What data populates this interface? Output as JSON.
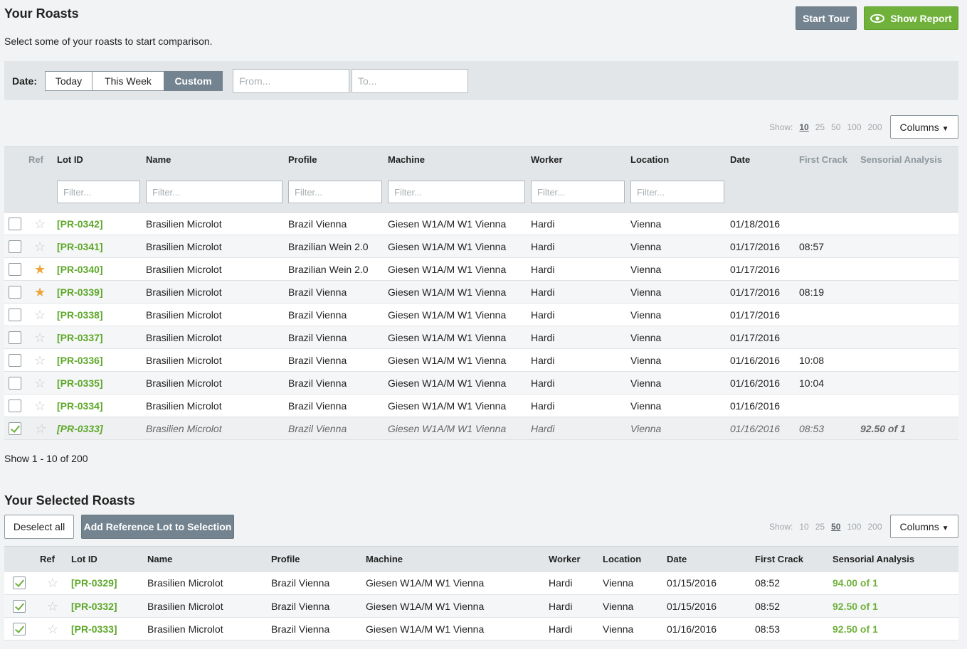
{
  "header": {
    "title": "Your Roasts",
    "subtitle": "Select some of your roasts to start comparison.",
    "tour_label": "Start Tour",
    "report_label": "Show Report"
  },
  "datebar": {
    "label": "Date:",
    "segments": [
      "Today",
      "This Week",
      "Custom"
    ],
    "active_segment": "Custom",
    "from_placeholder": "From...",
    "to_placeholder": "To..."
  },
  "pagination_top": {
    "show_label": "Show:",
    "options": [
      "10",
      "25",
      "50",
      "100",
      "200"
    ],
    "selected": "10",
    "columns_label": "Columns"
  },
  "roasts_table": {
    "headers": [
      "Ref",
      "Lot ID",
      "Name",
      "Profile",
      "Machine",
      "Worker",
      "Location",
      "Date",
      "First Crack",
      "Sensorial Analysis"
    ],
    "filter_placeholder": "Filter...",
    "rows": [
      {
        "checked": false,
        "starred": false,
        "lot": "[PR-0342]",
        "name": "Brasilien Microlot",
        "profile": "Brazil Vienna",
        "machine": "Giesen W1A/M W1 Vienna",
        "worker": "Hardi",
        "location": "Vienna",
        "date": "01/18/2016",
        "crack": "",
        "sens": ""
      },
      {
        "checked": false,
        "starred": false,
        "lot": "[PR-0341]",
        "name": "Brasilien Microlot",
        "profile": "Brazilian Wein 2.0",
        "machine": "Giesen W1A/M W1 Vienna",
        "worker": "Hardi",
        "location": "Vienna",
        "date": "01/17/2016",
        "crack": "08:57",
        "sens": ""
      },
      {
        "checked": false,
        "starred": true,
        "lot": "[PR-0340]",
        "name": "Brasilien Microlot",
        "profile": "Brazilian Wein 2.0",
        "machine": "Giesen W1A/M W1 Vienna",
        "worker": "Hardi",
        "location": "Vienna",
        "date": "01/17/2016",
        "crack": "",
        "sens": ""
      },
      {
        "checked": false,
        "starred": true,
        "lot": "[PR-0339]",
        "name": "Brasilien Microlot",
        "profile": "Brazil Vienna",
        "machine": "Giesen W1A/M W1 Vienna",
        "worker": "Hardi",
        "location": "Vienna",
        "date": "01/17/2016",
        "crack": "08:19",
        "sens": ""
      },
      {
        "checked": false,
        "starred": false,
        "lot": "[PR-0338]",
        "name": "Brasilien Microlot",
        "profile": "Brazil Vienna",
        "machine": "Giesen W1A/M W1 Vienna",
        "worker": "Hardi",
        "location": "Vienna",
        "date": "01/17/2016",
        "crack": "",
        "sens": ""
      },
      {
        "checked": false,
        "starred": false,
        "lot": "[PR-0337]",
        "name": "Brasilien Microlot",
        "profile": "Brazil Vienna",
        "machine": "Giesen W1A/M W1 Vienna",
        "worker": "Hardi",
        "location": "Vienna",
        "date": "01/17/2016",
        "crack": "",
        "sens": ""
      },
      {
        "checked": false,
        "starred": false,
        "lot": "[PR-0336]",
        "name": "Brasilien Microlot",
        "profile": "Brazil Vienna",
        "machine": "Giesen W1A/M W1 Vienna",
        "worker": "Hardi",
        "location": "Vienna",
        "date": "01/16/2016",
        "crack": "10:08",
        "sens": ""
      },
      {
        "checked": false,
        "starred": false,
        "lot": "[PR-0335]",
        "name": "Brasilien Microlot",
        "profile": "Brazil Vienna",
        "machine": "Giesen W1A/M W1 Vienna",
        "worker": "Hardi",
        "location": "Vienna",
        "date": "01/16/2016",
        "crack": "10:04",
        "sens": ""
      },
      {
        "checked": false,
        "starred": false,
        "lot": "[PR-0334]",
        "name": "Brasilien Microlot",
        "profile": "Brazil Vienna",
        "machine": "Giesen W1A/M W1 Vienna",
        "worker": "Hardi",
        "location": "Vienna",
        "date": "01/16/2016",
        "crack": "",
        "sens": ""
      },
      {
        "checked": true,
        "starred": false,
        "ref": true,
        "lot": "[PR-0333]",
        "name": "Brasilien Microlot",
        "profile": "Brazil Vienna",
        "machine": "Giesen W1A/M W1 Vienna",
        "worker": "Hardi",
        "location": "Vienna",
        "date": "01/16/2016",
        "crack": "08:53",
        "sens": "92.50 of 1"
      }
    ],
    "footer": "Show 1 - 10 of 200"
  },
  "selected": {
    "title": "Your Selected Roasts",
    "deselect_label": "Deselect all",
    "add_ref_label": "Add Reference Lot to Selection",
    "pagination": {
      "show_label": "Show:",
      "options": [
        "10",
        "25",
        "50",
        "100",
        "200"
      ],
      "selected": "50",
      "columns_label": "Columns"
    },
    "headers": [
      "Ref",
      "Lot ID",
      "Name",
      "Profile",
      "Machine",
      "Worker",
      "Location",
      "Date",
      "First Crack",
      "Sensorial Analysis"
    ],
    "rows": [
      {
        "checked": true,
        "starred": false,
        "lot": "[PR-0329]",
        "name": "Brasilien Microlot",
        "profile": "Brazil Vienna",
        "machine": "Giesen W1A/M W1 Vienna",
        "worker": "Hardi",
        "location": "Vienna",
        "date": "01/15/2016",
        "crack": "08:52",
        "sens": "94.00 of 1"
      },
      {
        "checked": true,
        "starred": false,
        "lot": "[PR-0332]",
        "name": "Brasilien Microlot",
        "profile": "Brazil Vienna",
        "machine": "Giesen W1A/M W1 Vienna",
        "worker": "Hardi",
        "location": "Vienna",
        "date": "01/15/2016",
        "crack": "08:52",
        "sens": "92.50 of 1"
      },
      {
        "checked": true,
        "starred": false,
        "lot": "[PR-0333]",
        "name": "Brasilien Microlot",
        "profile": "Brazil Vienna",
        "machine": "Giesen W1A/M W1 Vienna",
        "worker": "Hardi",
        "location": "Vienna",
        "date": "01/16/2016",
        "crack": "08:53",
        "sens": "92.50 of 1"
      }
    ]
  },
  "colors": {
    "accent_green": "#6fb13b",
    "slate_button": "#73838f",
    "star_active": "#f0a33a"
  }
}
